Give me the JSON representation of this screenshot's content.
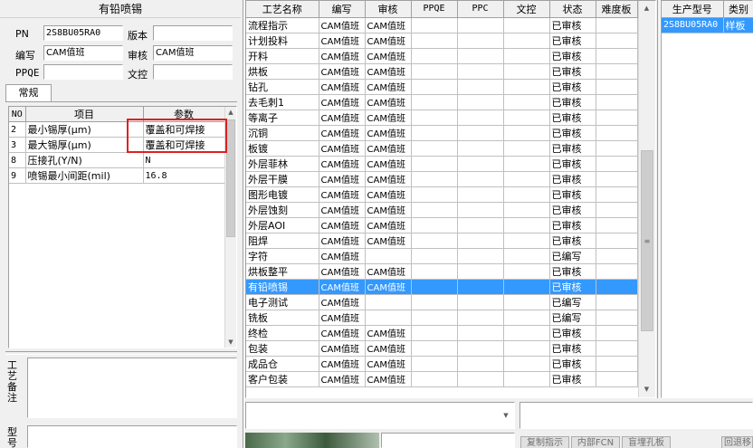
{
  "left": {
    "title": "有铅喷锡",
    "pn_label": "PN",
    "pn_value": "2S8BU05RA0",
    "version_label": "版本",
    "version_value": "",
    "author_label": "编写",
    "author_value": "CAM值班",
    "review_label": "审核",
    "review_value": "CAM值班",
    "ppqe_label": "PPQE",
    "ppqe_value": "",
    "clerk_label": "文控",
    "clerk_value": "",
    "tab_general": "常规",
    "param_columns": [
      "NO",
      "项目",
      "参数"
    ],
    "param_rows": [
      {
        "no": "2",
        "item": "最小锡厚(μm)",
        "param": "覆盖和可焊接"
      },
      {
        "no": "3",
        "item": "最大锡厚(μm)",
        "param": "覆盖和可焊接"
      },
      {
        "no": "8",
        "item": "压接孔(Y/N)",
        "param": "N"
      },
      {
        "no": "9",
        "item": "喷锡最小间距(mil)",
        "param": "16.8"
      }
    ],
    "notes_label": "工艺备注",
    "type_label": "型号"
  },
  "process": {
    "columns": [
      "工艺名称",
      "编写",
      "审核",
      "PPQE",
      "PPC",
      "文控",
      "状态",
      "难度板"
    ],
    "rows": [
      {
        "name": "流程指示",
        "author": "CAM值班",
        "review": "CAM值班",
        "ppqe": "",
        "ppc": "",
        "clerk": "",
        "status": "已审核",
        "difficulty": ""
      },
      {
        "name": "计划投料",
        "author": "CAM值班",
        "review": "CAM值班",
        "ppqe": "",
        "ppc": "",
        "clerk": "",
        "status": "已审核",
        "difficulty": ""
      },
      {
        "name": "开料",
        "author": "CAM值班",
        "review": "CAM值班",
        "ppqe": "",
        "ppc": "",
        "clerk": "",
        "status": "已审核",
        "difficulty": ""
      },
      {
        "name": "烘板",
        "author": "CAM值班",
        "review": "CAM值班",
        "ppqe": "",
        "ppc": "",
        "clerk": "",
        "status": "已审核",
        "difficulty": ""
      },
      {
        "name": "钻孔",
        "author": "CAM值班",
        "review": "CAM值班",
        "ppqe": "",
        "ppc": "",
        "clerk": "",
        "status": "已审核",
        "difficulty": ""
      },
      {
        "name": "去毛刺1",
        "author": "CAM值班",
        "review": "CAM值班",
        "ppqe": "",
        "ppc": "",
        "clerk": "",
        "status": "已审核",
        "difficulty": ""
      },
      {
        "name": "等离子",
        "author": "CAM值班",
        "review": "CAM值班",
        "ppqe": "",
        "ppc": "",
        "clerk": "",
        "status": "已审核",
        "difficulty": ""
      },
      {
        "name": "沉铜",
        "author": "CAM值班",
        "review": "CAM值班",
        "ppqe": "",
        "ppc": "",
        "clerk": "",
        "status": "已审核",
        "difficulty": ""
      },
      {
        "name": "板镀",
        "author": "CAM值班",
        "review": "CAM值班",
        "ppqe": "",
        "ppc": "",
        "clerk": "",
        "status": "已审核",
        "difficulty": ""
      },
      {
        "name": "外层菲林",
        "author": "CAM值班",
        "review": "CAM值班",
        "ppqe": "",
        "ppc": "",
        "clerk": "",
        "status": "已审核",
        "difficulty": ""
      },
      {
        "name": "外层干膜",
        "author": "CAM值班",
        "review": "CAM值班",
        "ppqe": "",
        "ppc": "",
        "clerk": "",
        "status": "已审核",
        "difficulty": ""
      },
      {
        "name": "图形电镀",
        "author": "CAM值班",
        "review": "CAM值班",
        "ppqe": "",
        "ppc": "",
        "clerk": "",
        "status": "已审核",
        "difficulty": ""
      },
      {
        "name": "外层蚀刻",
        "author": "CAM值班",
        "review": "CAM值班",
        "ppqe": "",
        "ppc": "",
        "clerk": "",
        "status": "已审核",
        "difficulty": ""
      },
      {
        "name": "外层AOI",
        "author": "CAM值班",
        "review": "CAM值班",
        "ppqe": "",
        "ppc": "",
        "clerk": "",
        "status": "已审核",
        "difficulty": ""
      },
      {
        "name": "阻焊",
        "author": "CAM值班",
        "review": "CAM值班",
        "ppqe": "",
        "ppc": "",
        "clerk": "",
        "status": "已审核",
        "difficulty": ""
      },
      {
        "name": "字符",
        "author": "CAM值班",
        "review": "",
        "ppqe": "",
        "ppc": "",
        "clerk": "",
        "status": "已编写",
        "difficulty": ""
      },
      {
        "name": "烘板整平",
        "author": "CAM值班",
        "review": "CAM值班",
        "ppqe": "",
        "ppc": "",
        "clerk": "",
        "status": "已审核",
        "difficulty": ""
      },
      {
        "name": "有铅喷锡",
        "author": "CAM值班",
        "review": "CAM值班",
        "ppqe": "",
        "ppc": "",
        "clerk": "",
        "status": "已审核",
        "difficulty": ""
      },
      {
        "name": "电子测试",
        "author": "CAM值班",
        "review": "",
        "ppqe": "",
        "ppc": "",
        "clerk": "",
        "status": "已编写",
        "difficulty": ""
      },
      {
        "name": "铣板",
        "author": "CAM值班",
        "review": "",
        "ppqe": "",
        "ppc": "",
        "clerk": "",
        "status": "已编写",
        "difficulty": ""
      },
      {
        "name": "终检",
        "author": "CAM值班",
        "review": "CAM值班",
        "ppqe": "",
        "ppc": "",
        "clerk": "",
        "status": "已审核",
        "difficulty": ""
      },
      {
        "name": "包装",
        "author": "CAM值班",
        "review": "CAM值班",
        "ppqe": "",
        "ppc": "",
        "clerk": "",
        "status": "已审核",
        "difficulty": ""
      },
      {
        "name": "成品仓",
        "author": "CAM值班",
        "review": "CAM值班",
        "ppqe": "",
        "ppc": "",
        "clerk": "",
        "status": "已审核",
        "difficulty": ""
      },
      {
        "name": "客户包装",
        "author": "CAM值班",
        "review": "CAM值班",
        "ppqe": "",
        "ppc": "",
        "clerk": "",
        "status": "已审核",
        "difficulty": ""
      }
    ],
    "selected_index": 17
  },
  "right": {
    "columns": [
      "生产型号",
      "类别"
    ],
    "rows": [
      {
        "model": "2S8BU05RA0",
        "category": "样板"
      }
    ]
  },
  "bottom_buttons": [
    "复制指示",
    "内部FCN",
    "盲埋孔板",
    "回退移"
  ],
  "colors": {
    "selection": "#3399ff",
    "highlight_box": "#e02020"
  }
}
